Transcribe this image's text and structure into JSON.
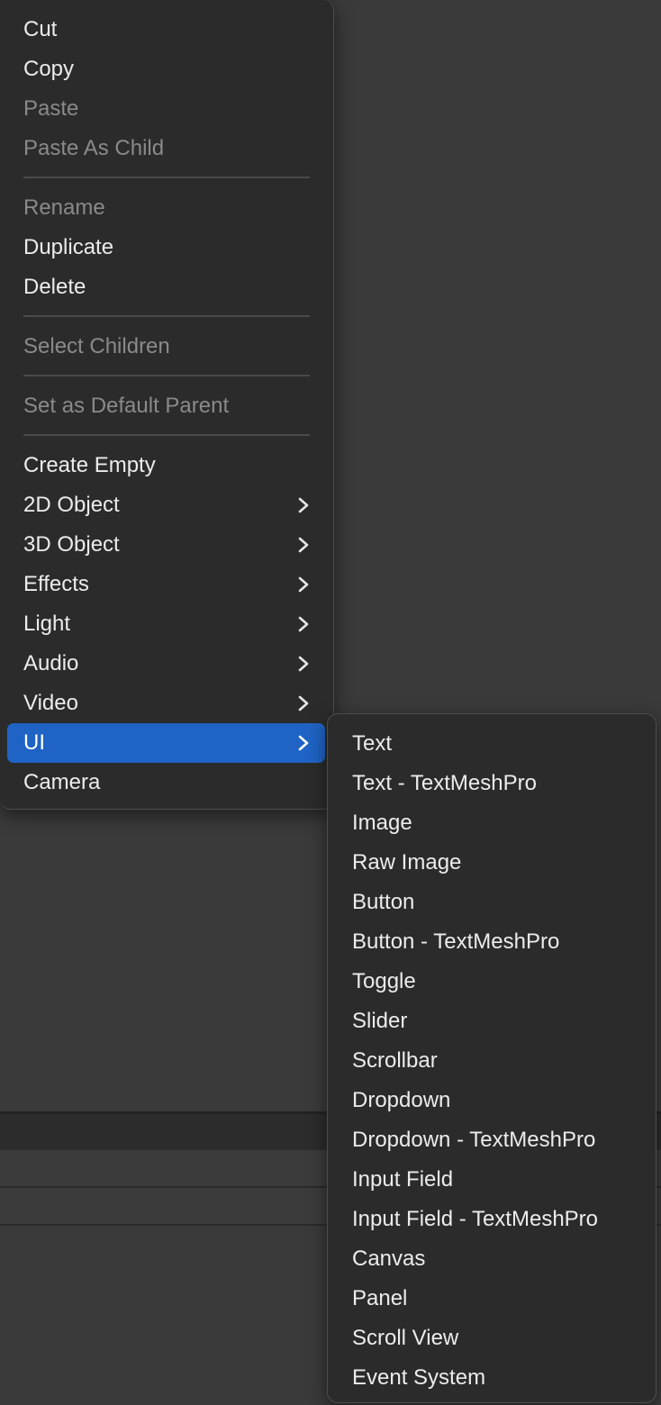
{
  "main_menu": {
    "items": [
      {
        "label": "Cut",
        "enabled": true
      },
      {
        "label": "Copy",
        "enabled": true
      },
      {
        "label": "Paste",
        "enabled": false
      },
      {
        "label": "Paste As Child",
        "enabled": false
      },
      {
        "label": "Rename",
        "enabled": false
      },
      {
        "label": "Duplicate",
        "enabled": true
      },
      {
        "label": "Delete",
        "enabled": true
      },
      {
        "label": "Select Children",
        "enabled": false
      },
      {
        "label": "Set as Default Parent",
        "enabled": false
      },
      {
        "label": "Create Empty",
        "enabled": true
      },
      {
        "label": "2D Object",
        "enabled": true,
        "submenu": true
      },
      {
        "label": "3D Object",
        "enabled": true,
        "submenu": true
      },
      {
        "label": "Effects",
        "enabled": true,
        "submenu": true
      },
      {
        "label": "Light",
        "enabled": true,
        "submenu": true
      },
      {
        "label": "Audio",
        "enabled": true,
        "submenu": true
      },
      {
        "label": "Video",
        "enabled": true,
        "submenu": true
      },
      {
        "label": "UI",
        "enabled": true,
        "submenu": true,
        "highlighted": true
      },
      {
        "label": "Camera",
        "enabled": true
      }
    ]
  },
  "ui_submenu": {
    "items": [
      "Text",
      "Text - TextMeshPro",
      "Image",
      "Raw Image",
      "Button",
      "Button - TextMeshPro",
      "Toggle",
      "Slider",
      "Scrollbar",
      "Dropdown",
      "Dropdown - TextMeshPro",
      "Input Field",
      "Input Field - TextMeshPro",
      "Canvas",
      "Panel",
      "Scroll View",
      "Event System"
    ]
  },
  "colors": {
    "menu_bg": "#2b2b2b",
    "highlight": "#1f63c4",
    "text": "#ececec",
    "disabled_text": "#8a8a8a"
  },
  "icons": {
    "submenu_arrow": "chevron-right-icon"
  }
}
